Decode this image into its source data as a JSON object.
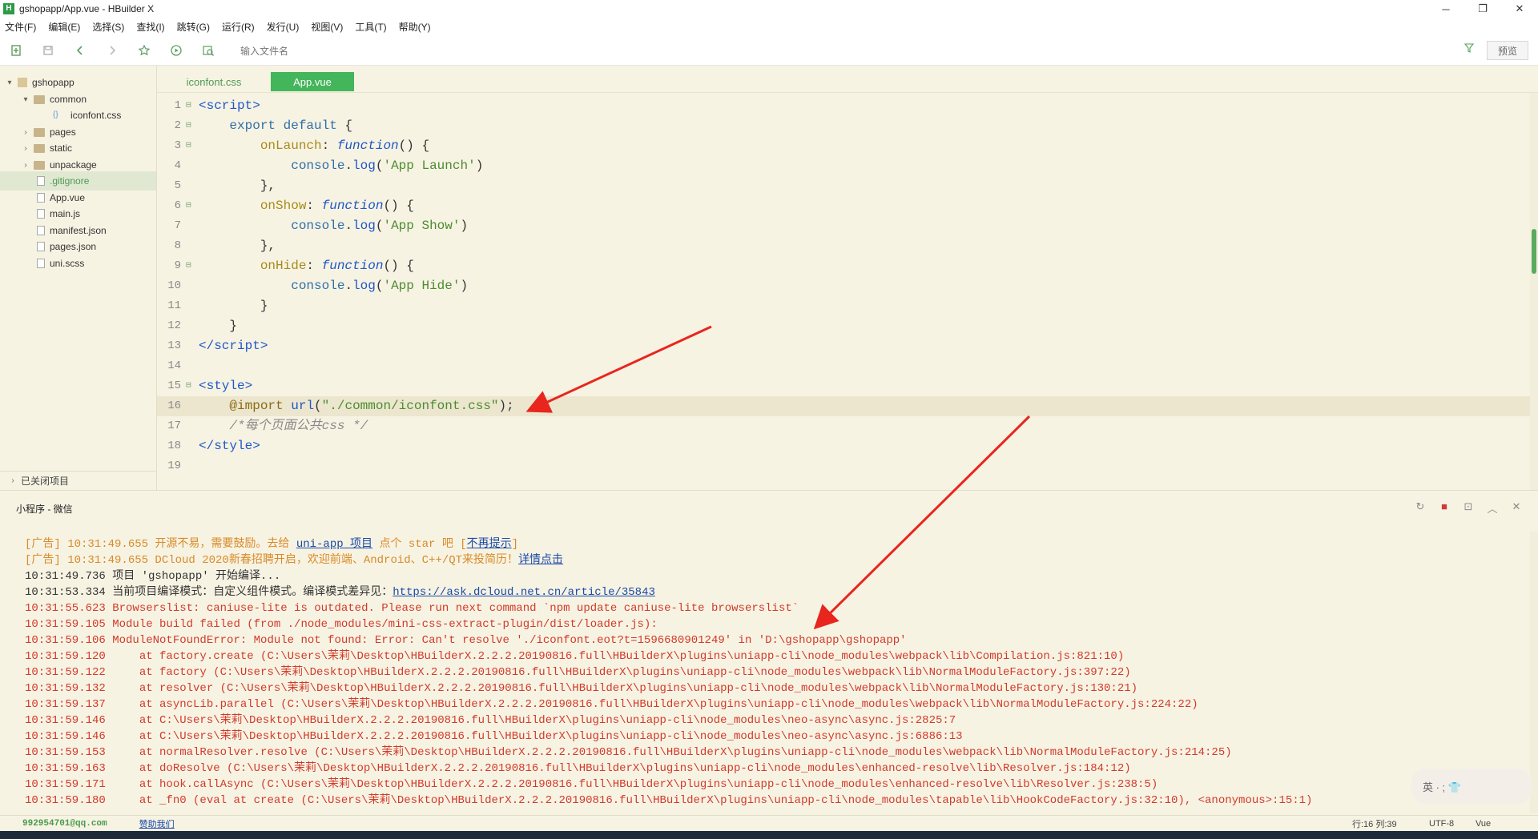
{
  "window": {
    "title": "gshopapp/App.vue - HBuilder X",
    "logo": "H"
  },
  "winbtns": {
    "min": "─",
    "restore": "❐",
    "close": "✕"
  },
  "menu": [
    "文件(F)",
    "编辑(E)",
    "选择(S)",
    "查找(I)",
    "跳转(G)",
    "运行(R)",
    "发行(U)",
    "视图(V)",
    "工具(T)",
    "帮助(Y)"
  ],
  "toolbar": {
    "file_placeholder": "输入文件名",
    "preview_label": "预览"
  },
  "sidebar": {
    "items": [
      {
        "label": "gshopapp"
      },
      {
        "label": "common"
      },
      {
        "label": "iconfont.css"
      },
      {
        "label": "pages"
      },
      {
        "label": "static"
      },
      {
        "label": "unpackage"
      },
      {
        "label": ".gitignore"
      },
      {
        "label": "App.vue"
      },
      {
        "label": "main.js"
      },
      {
        "label": "manifest.json"
      },
      {
        "label": "pages.json"
      },
      {
        "label": "uni.scss"
      }
    ],
    "closed_projects": "已关闭项目"
  },
  "tabs": [
    {
      "label": "iconfont.css"
    },
    {
      "label": "App.vue"
    }
  ],
  "editor": {
    "line_numbers": [
      "1",
      "2",
      "3",
      "4",
      "5",
      "6",
      "7",
      "8",
      "9",
      "10",
      "11",
      "12",
      "13",
      "14",
      "15",
      "16",
      "17",
      "18",
      "19"
    ]
  },
  "panel": {
    "title": "小程序 - 微信"
  },
  "console": {
    "ad1": {
      "prefix": "[广告] 10:31:49.655 开源不易，需要鼓励。去给 ",
      "link": "uni-app 项目",
      "suffix": " 点个 star 吧 [",
      "dismiss": "不再提示",
      "end": "]"
    },
    "ad2": {
      "prefix": "[广告] 10:31:49.655 DCloud 2020新春招聘开启，欢迎前端、Android、C++/QT来投简历！",
      "link": "详情点击"
    },
    "l3": "10:31:49.736 项目 'gshopapp' 开始编译...",
    "l4": {
      "text": "10:31:53.334 当前项目编译模式：自定义组件模式。编译模式差异见：",
      "link": "https://ask.dcloud.net.cn/article/35843"
    },
    "errors": [
      "10:31:55.623 Browserslist: caniuse-lite is outdated. Please run next command `npm update caniuse-lite browserslist`",
      "10:31:59.105 Module build failed (from ./node_modules/mini-css-extract-plugin/dist/loader.js):",
      "10:31:59.106 ModuleNotFoundError: Module not found: Error: Can't resolve './iconfont.eot?t=1596680901249' in 'D:\\gshopapp\\gshopapp'",
      "10:31:59.120     at factory.create (C:\\Users\\茉莉\\Desktop\\HBuilderX.2.2.2.20190816.full\\HBuilderX\\plugins\\uniapp-cli\\node_modules\\webpack\\lib\\Compilation.js:821:10)",
      "10:31:59.122     at factory (C:\\Users\\茉莉\\Desktop\\HBuilderX.2.2.2.20190816.full\\HBuilderX\\plugins\\uniapp-cli\\node_modules\\webpack\\lib\\NormalModuleFactory.js:397:22)",
      "10:31:59.132     at resolver (C:\\Users\\茉莉\\Desktop\\HBuilderX.2.2.2.20190816.full\\HBuilderX\\plugins\\uniapp-cli\\node_modules\\webpack\\lib\\NormalModuleFactory.js:130:21)",
      "10:31:59.137     at asyncLib.parallel (C:\\Users\\茉莉\\Desktop\\HBuilderX.2.2.2.20190816.full\\HBuilderX\\plugins\\uniapp-cli\\node_modules\\webpack\\lib\\NormalModuleFactory.js:224:22)",
      "10:31:59.146     at C:\\Users\\茉莉\\Desktop\\HBuilderX.2.2.2.20190816.full\\HBuilderX\\plugins\\uniapp-cli\\node_modules\\neo-async\\async.js:2825:7",
      "10:31:59.146     at C:\\Users\\茉莉\\Desktop\\HBuilderX.2.2.2.20190816.full\\HBuilderX\\plugins\\uniapp-cli\\node_modules\\neo-async\\async.js:6886:13",
      "10:31:59.153     at normalResolver.resolve (C:\\Users\\茉莉\\Desktop\\HBuilderX.2.2.2.20190816.full\\HBuilderX\\plugins\\uniapp-cli\\node_modules\\webpack\\lib\\NormalModuleFactory.js:214:25)",
      "10:31:59.163     at doResolve (C:\\Users\\茉莉\\Desktop\\HBuilderX.2.2.2.20190816.full\\HBuilderX\\plugins\\uniapp-cli\\node_modules\\enhanced-resolve\\lib\\Resolver.js:184:12)",
      "10:31:59.171     at hook.callAsync (C:\\Users\\茉莉\\Desktop\\HBuilderX.2.2.2.20190816.full\\HBuilderX\\plugins\\uniapp-cli\\node_modules\\enhanced-resolve\\lib\\Resolver.js:238:5)",
      "10:31:59.180     at _fn0 (eval at create (C:\\Users\\茉莉\\Desktop\\HBuilderX.2.2.2.20190816.full\\HBuilderX\\plugins\\uniapp-cli\\node_modules\\tapable\\lib\\HookCodeFactory.js:32:10), <anonymous>:15:1)"
    ]
  },
  "status": {
    "email": "992954701@qq.com",
    "sponsor": "赞助我们",
    "pos": "行:16  列:39",
    "enc": "UTF-8",
    "lang": "Vue"
  },
  "ime": {
    "label": "英 · ; 👕"
  },
  "colors": {
    "accent": "#43b55a",
    "error": "#d23a2a",
    "ad": "#d98a28",
    "bg": "#f7f3e3"
  }
}
